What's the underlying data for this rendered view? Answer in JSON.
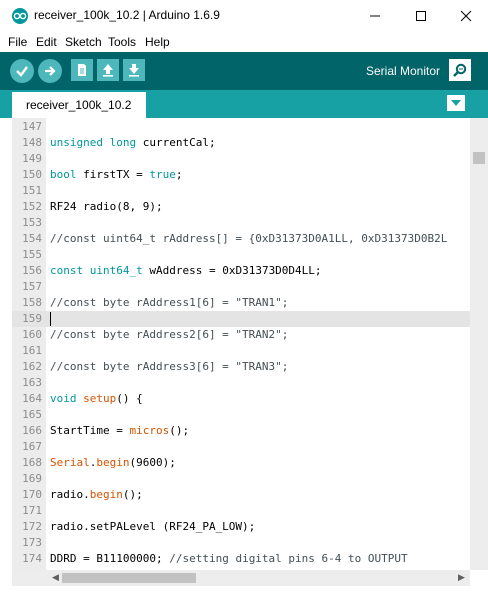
{
  "window": {
    "title": "receiver_100k_10.2 | Arduino 1.6.9",
    "app_icon": "arduino-logo-icon"
  },
  "menu": {
    "items": [
      "File",
      "Edit",
      "Sketch",
      "Tools",
      "Help"
    ]
  },
  "toolbar": {
    "buttons": [
      "verify-icon",
      "upload-icon",
      "new-icon",
      "open-icon",
      "save-icon"
    ],
    "serial_monitor_label": "Serial Monitor",
    "serial_monitor_icon": "magnifier-icon"
  },
  "tabs": {
    "active_label": "receiver_100k_10.2",
    "menu_icon": "chevron-down-icon"
  },
  "colors": {
    "toolbar_bg": "#006468",
    "tabbar_bg": "#17a1a5",
    "button_bg": "#4db7bb",
    "keyword": "#00979c",
    "function": "#d35400",
    "highlight": "#22a12f"
  },
  "editor": {
    "current_line": "159",
    "lines": [
      {
        "n": "147",
        "t": ""
      },
      {
        "n": "148",
        "t": "unsigned long currentCal;"
      },
      {
        "n": "149",
        "t": ""
      },
      {
        "n": "150",
        "t": "bool firstTX = true;"
      },
      {
        "n": "151",
        "t": ""
      },
      {
        "n": "152",
        "t": "RF24 radio(8, 9);"
      },
      {
        "n": "153",
        "t": ""
      },
      {
        "n": "154",
        "t": "//const uint64_t rAddress[] = {0xD31373D0A1LL, 0xD31373D0B2L"
      },
      {
        "n": "155",
        "t": ""
      },
      {
        "n": "156",
        "t": "const uint64_t wAddress = 0xD31373D0D4LL;"
      },
      {
        "n": "157",
        "t": ""
      },
      {
        "n": "158",
        "t": "//const byte rAddress1[6] = \"TRAN1\";"
      },
      {
        "n": "159",
        "t": ""
      },
      {
        "n": "160",
        "t": "//const byte rAddress2[6] = \"TRAN2\";"
      },
      {
        "n": "161",
        "t": ""
      },
      {
        "n": "162",
        "t": "//const byte rAddress3[6] = \"TRAN3\";"
      },
      {
        "n": "163",
        "t": ""
      },
      {
        "n": "164",
        "t": "void setup() {"
      },
      {
        "n": "165",
        "t": ""
      },
      {
        "n": "166",
        "t": "StartTime = micros();"
      },
      {
        "n": "167",
        "t": ""
      },
      {
        "n": "168",
        "t": "Serial.begin(9600);"
      },
      {
        "n": "169",
        "t": ""
      },
      {
        "n": "170",
        "t": "radio.begin();"
      },
      {
        "n": "171",
        "t": ""
      },
      {
        "n": "172",
        "t": "radio.setPALevel (RF24_PA_LOW);"
      },
      {
        "n": "173",
        "t": ""
      },
      {
        "n": "174",
        "t": "DDRD = B11100000; //setting digital pins 6-4 to OUTPUT"
      },
      {
        "n": "175",
        "t": ""
      }
    ]
  }
}
